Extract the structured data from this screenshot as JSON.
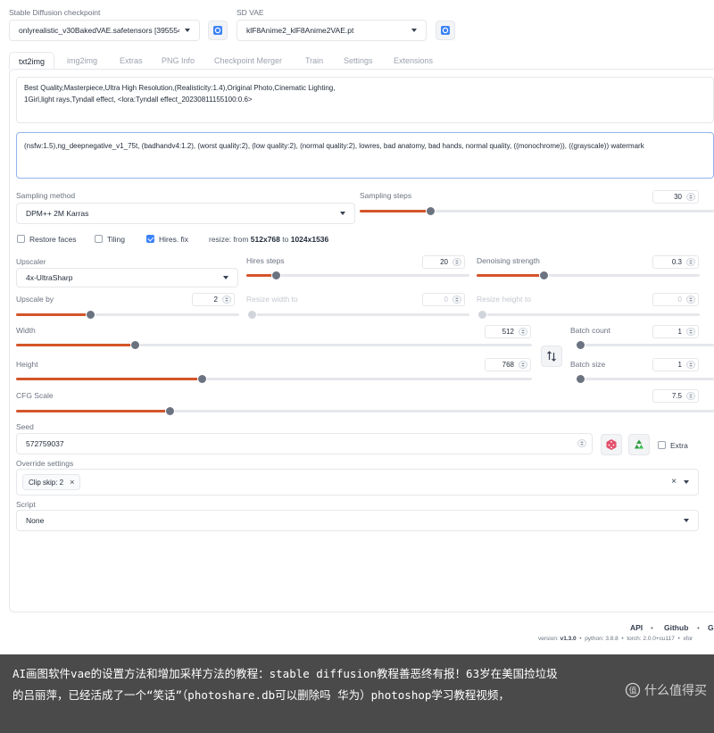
{
  "header": {
    "checkpoint_label": "Stable Diffusion checkpoint",
    "checkpoint_value": "onlyrealistic_v30BakedVAE.safetensors [395554",
    "vae_label": "SD VAE",
    "vae_value": "klF8Anime2_klF8Anime2VAE.pt"
  },
  "tabs": [
    "txt2img",
    "img2img",
    "Extras",
    "PNG Info",
    "Checkpoint Merger",
    "Train",
    "Settings",
    "Extensions"
  ],
  "prompt": {
    "line1": "Best Quality,Masterpiece,Ultra High Resolution,(Realisticity:1.4),Original Photo,Cinematic Lighting,",
    "line2": "1Girl,light rays,Tyndall effect, <lora:Tyndall effect_20230811155100:0.6>"
  },
  "negative_prompt": "(nsfw:1.5),ng_deepnegative_v1_75t, (badhandv4:1.2), (worst quality:2), (low quality:2), (normal quality:2), lowres, bad anatomy, bad hands, normal quality, ((monochrome)), ((grayscale)) watermark",
  "sampling": {
    "method_label": "Sampling method",
    "method_value": "DPM++ 2M Karras",
    "steps_label": "Sampling steps",
    "steps_value": "30",
    "steps_fraction": 0.2
  },
  "options": {
    "restore_faces": "Restore faces",
    "tiling": "Tiling",
    "hires_fix": "Hires. fix",
    "resize_prefix": "resize: from",
    "resize_from": "512x768",
    "resize_to_word": "to",
    "resize_to": "1024x1536"
  },
  "hires": {
    "upscaler_label": "Upscaler",
    "upscaler_value": "4x-UltraSharp",
    "steps_label": "Hires steps",
    "steps_value": "20",
    "steps_fraction": 0.13,
    "denoise_label": "Denoising strength",
    "denoise_value": "0.3",
    "denoise_fraction": 0.3,
    "upscale_by_label": "Upscale by",
    "upscale_by_value": "2",
    "upscale_by_fraction": 0.33,
    "resize_w_label": "Resize width to",
    "resize_w_value": "0",
    "resize_h_label": "Resize height to",
    "resize_h_value": "0"
  },
  "size": {
    "width_label": "Width",
    "width_value": "512",
    "width_fraction": 0.23,
    "height_label": "Height",
    "height_value": "768",
    "height_fraction": 0.36,
    "swap_icon": "swap-vertical-icon",
    "batch_count_label": "Batch count",
    "batch_count_value": "1",
    "batch_count_fraction": 0.0,
    "batch_size_label": "Batch size",
    "batch_size_value": "1",
    "batch_size_fraction": 0.0
  },
  "cfg": {
    "label": "CFG Scale",
    "value": "7.5",
    "fraction": 0.22
  },
  "seed": {
    "label": "Seed",
    "value": "572759037",
    "extra_label": "Extra",
    "dice_icon": "dice-icon",
    "recycle_icon": "recycle-icon"
  },
  "override": {
    "label": "Override settings",
    "chip": "Clip skip: 2"
  },
  "script": {
    "label": "Script",
    "value": "None"
  },
  "footer": {
    "api": "API",
    "github": "Github",
    "cut": "G",
    "sep": "•",
    "version_prefix": "version:",
    "version": "v1.3.0",
    "python": "python: 3.8.8",
    "torch": "torch: 2.0.0+cu117",
    "xformers": "xfor"
  },
  "caption": {
    "text": "AI画图软件vae的设置方法和增加采样方法的教程：stable diffusion教程善恶终有报！63岁在美国捡垃圾的吕丽萍，已经活成了一个“笑话”（photoshare.db可以删除吗 华为）photoshop学习教程视频，",
    "watermark": "什么值得买",
    "watermark_icon": "zhide-logo-icon"
  },
  "colors": {
    "accent": "#d4552a",
    "checkbox": "#3b82f6",
    "caption_bg": "#4a4a4a"
  }
}
